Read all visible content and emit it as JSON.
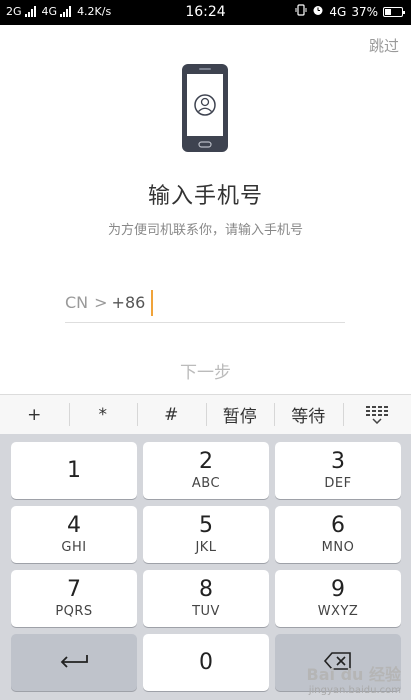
{
  "status_bar": {
    "net1": "2G",
    "net2": "4G",
    "speed": "4.2K/s",
    "time": "16:24",
    "right_net": "4G",
    "battery": "37%",
    "battery_level": 0.37
  },
  "header": {
    "skip_label": "跳过",
    "title": "输入手机号",
    "subtitle": "为方便司机联系你，请输入手机号"
  },
  "phone_input": {
    "country": "CN",
    "chevron": ">",
    "prefix": "+86"
  },
  "next_label": "下一步",
  "toolbar": {
    "keys": [
      "+",
      "*",
      "#",
      "暂停",
      "等待"
    ]
  },
  "keypad": {
    "keys": [
      {
        "num": "1",
        "letters": ""
      },
      {
        "num": "2",
        "letters": "ABC"
      },
      {
        "num": "3",
        "letters": "DEF"
      },
      {
        "num": "4",
        "letters": "GHI"
      },
      {
        "num": "5",
        "letters": "JKL"
      },
      {
        "num": "6",
        "letters": "MNO"
      },
      {
        "num": "7",
        "letters": "PQRS"
      },
      {
        "num": "8",
        "letters": "TUV"
      },
      {
        "num": "9",
        "letters": "WXYZ"
      },
      {
        "num": "0",
        "letters": ""
      }
    ]
  },
  "watermark": {
    "brand": "Bai du 经验",
    "url": "jingyan.baidu.com"
  }
}
